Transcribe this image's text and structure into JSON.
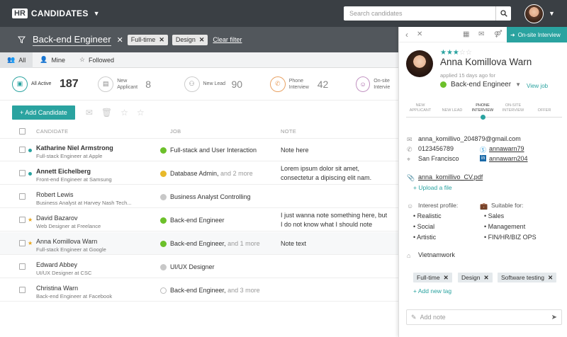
{
  "app": {
    "logo": "HR",
    "title": "CANDIDATES"
  },
  "search": {
    "placeholder": "Search candidates"
  },
  "filter": {
    "title": "Back-end Engineer",
    "chips": [
      "Full-time",
      "Design"
    ],
    "clear": "Clear filter"
  },
  "tabs": [
    "All",
    "Mine",
    "Followed"
  ],
  "stages": [
    {
      "label": "All Active",
      "count": "187"
    },
    {
      "label": "New Applicant",
      "count": "8"
    },
    {
      "label": "New Lead",
      "count": "90"
    },
    {
      "label": "Phone Interview",
      "count": "42"
    },
    {
      "label": "On-site Intervie"
    }
  ],
  "toolbar": {
    "add": "+ Add Candidate"
  },
  "columns": {
    "candidate": "CANDIDATE",
    "job": "JOB",
    "note": "NOTE"
  },
  "colors": {
    "accent": "#2aa3a0",
    "green": "#6cc02a",
    "yellow": "#e8b92a",
    "gray": "#c8c8c8"
  },
  "rows": [
    {
      "name": "Katharine Niel Armstrong",
      "sub": "Full-stack Engineer at Apple",
      "job": "Full-stack and User Interaction",
      "more": "",
      "note1": "Note here",
      "note2": "",
      "bold": true,
      "mark": "dot",
      "jobColor": "green"
    },
    {
      "name": "Annett Eichelberg",
      "sub": "Front-end Engineer at Samsung",
      "job": "Database Admin,",
      "more": " and 2 more",
      "note1": "Lorem ipsum dolor sit amet,",
      "note2": "consectetur a dipiscing elit nam.",
      "bold": true,
      "mark": "dot",
      "jobColor": "yellow"
    },
    {
      "name": "Robert Lewis",
      "sub": "Business Analyst at Harvey Nash Tech...",
      "job": "Business Analyst Controlling",
      "more": "",
      "note1": "",
      "note2": "",
      "bold": false,
      "mark": "",
      "jobColor": "gray"
    },
    {
      "name": "David Bazarov",
      "sub": "Web Designer at Freelance",
      "job": "Back-end Engineer",
      "more": "",
      "note1": "I just wanna note something here, but",
      "note2": "I do not know what I should note",
      "bold": false,
      "mark": "star",
      "jobColor": "green"
    },
    {
      "name": "Anna Komillova Warn",
      "sub": "Full-stack Engineer at Google",
      "job": "Back-end Engineer,",
      "more": " and 1 more",
      "note1": "Note text",
      "note2": "",
      "bold": false,
      "mark": "star",
      "jobColor": "green"
    },
    {
      "name": "Edward Abbey",
      "sub": "UI/UX Designer at CSC",
      "job": "UI/UX Designer",
      "more": "",
      "note1": "",
      "note2": "",
      "bold": false,
      "mark": "",
      "jobColor": "gray"
    },
    {
      "name": "Christina Warn",
      "sub": "Back-end Engineer at Facebook",
      "job": "Back-end Engineer,",
      "more": " and 3 more",
      "note1": "",
      "note2": "",
      "bold": false,
      "mark": "",
      "jobColor": "empty"
    }
  ],
  "panel": {
    "onsite": "On-site Interview",
    "name": "Anna Komillova Warn",
    "rating": 3,
    "applied": "applied 15 days ago for",
    "job": "Back-end Engineer",
    "viewjob": "View job",
    "pipeline": [
      {
        "l1": "NEW",
        "l2": "APPLICANT"
      },
      {
        "l1": "",
        "l2": "NEW LEAD"
      },
      {
        "l1": "PHONE",
        "l2": "INTERVIEW"
      },
      {
        "l1": "ON-SITE",
        "l2": "INTERVIEW"
      },
      {
        "l1": "",
        "l2": "OFFER"
      }
    ],
    "email": "anna_komillivo_204879@gmail.com",
    "phone": "0123456789",
    "skype": "annawarn79",
    "city": "San Francisco",
    "linkedin": "annawarn204",
    "cv": "anna_komillivo_CV.pdf",
    "upload": "+ Upload a file",
    "interest_title": "Interest profile:",
    "interests": [
      "Realistic",
      "Social",
      "Artistic"
    ],
    "suitable_title": "Suitable for:",
    "suitable": [
      "Sales",
      "Management",
      "FIN/HR/BIZ OPS"
    ],
    "source": "Vietnamwork",
    "tags": [
      "Full-time",
      "Design",
      "Software testing"
    ],
    "addtag": "+ Add new tag",
    "note_placeholder": "Add note"
  }
}
